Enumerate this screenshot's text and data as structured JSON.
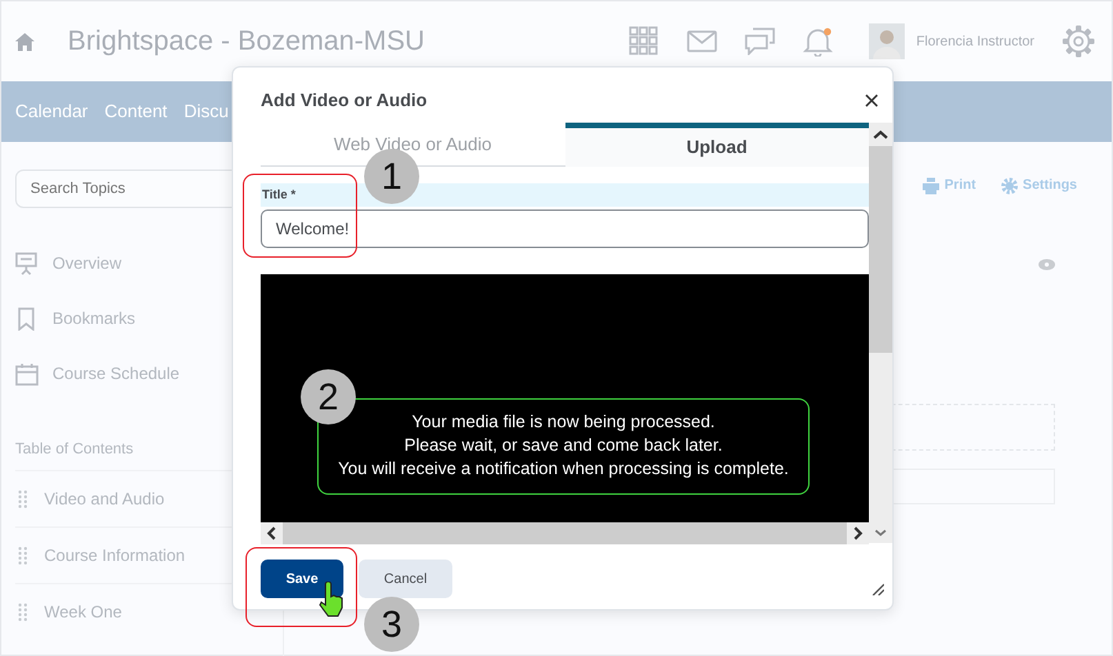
{
  "header": {
    "title": "Brightspace - Bozeman-MSU",
    "user_name": "Florencia Instructor",
    "notification_dot": true
  },
  "nav": [
    "Calendar",
    "Content",
    "Discu"
  ],
  "sidebar": {
    "search_placeholder": "Search Topics",
    "links": [
      {
        "kind": "presentation",
        "label": "Overview"
      },
      {
        "kind": "bookmark",
        "label": "Bookmarks"
      },
      {
        "kind": "calendar",
        "label": "Course Schedule"
      }
    ],
    "toc": {
      "label": "Table of Contents"
    },
    "modules": [
      {
        "label": "Video and Audio"
      },
      {
        "label": "Course Information"
      },
      {
        "label": "Week One"
      }
    ]
  },
  "toolbar": [
    {
      "kind": "print",
      "label": "Print"
    },
    {
      "kind": "settings",
      "label": "Settings"
    }
  ],
  "dialog": {
    "title": "Add Video or Audio",
    "tabs": [
      {
        "label": "Web Video or Audio",
        "selected": false
      },
      {
        "label": "Upload",
        "selected": true
      }
    ],
    "field": {
      "label": "Title",
      "required_mark": "*",
      "value": "Welcome!"
    },
    "message": [
      "Your media file is now being processed.",
      "Please wait, or save and come back later.",
      "You will receive a notification when processing is complete."
    ],
    "buttons": [
      {
        "kind": "primary",
        "label": "Save"
      },
      {
        "kind": "secondary",
        "label": "Cancel"
      }
    ]
  },
  "annotations": [
    "1",
    "2",
    "3"
  ]
}
